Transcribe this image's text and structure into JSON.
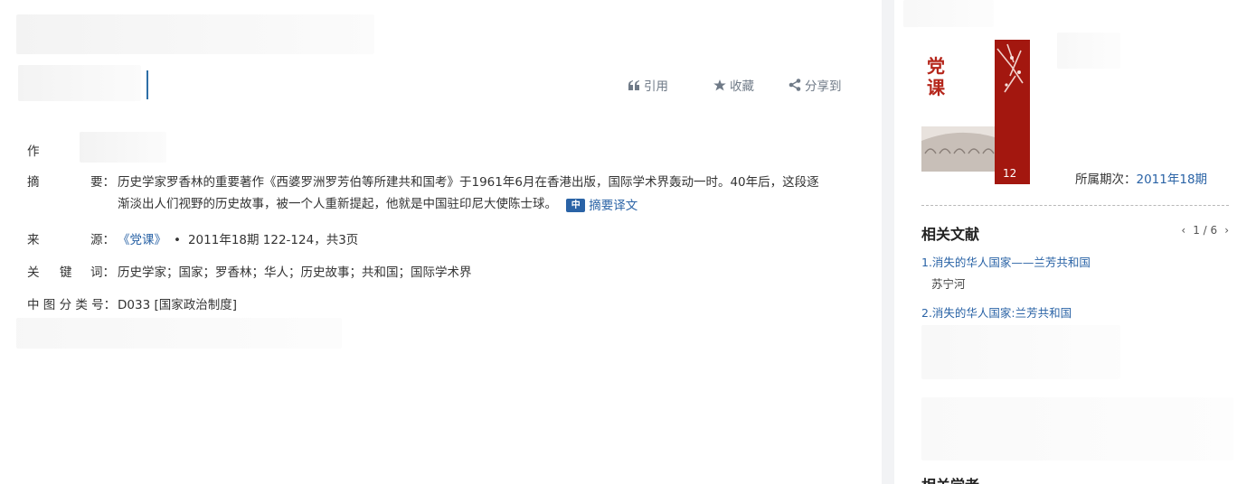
{
  "actions": {
    "cite": "引用",
    "favorite": "收藏",
    "share": "分享到"
  },
  "meta": {
    "author_label": "作",
    "abstract_label": [
      "摘",
      "要："
    ],
    "abstract_text": "历史学家罗香林的重要著作《西婆罗洲罗芳伯等所建共和国考》于1961年6月在香港出版，国际学术界轰动一时。40年后，这段逐渐淡出人们视野的历史故事，被一个人重新提起，他就是中国驻印尼大使陈士球。",
    "abstract_translate": "摘要译文",
    "translate_icon": "中",
    "source_label": [
      "来",
      "源："
    ],
    "source_journal": "《党课》",
    "source_detail": "2011年18期 122-124，共3页",
    "keywords_label": [
      "关",
      "键",
      "词："
    ],
    "keywords": "历史学家；国家；罗香林；华人；历史故事；共和国；国际学术界",
    "clc_label": "中 图 分 类 号：",
    "clc_value": "D033 [国家政治制度]"
  },
  "sidebar": {
    "cover": {
      "title_line1": "党",
      "title_line2": "课",
      "issue_no": "12"
    },
    "issue_label": "所属期次：",
    "issue_value": "2011年18期",
    "related_title": "相关文献",
    "pager": "1 / 6",
    "related": [
      {
        "title": "1.消失的华人国家——兰芳共和国",
        "author": "苏宁河"
      },
      {
        "title": "2.消失的华人国家:兰芳共和国",
        "author": ""
      }
    ],
    "scholars_title": "相关学者"
  },
  "colors": {
    "link": "#2a63a6",
    "cover_red": "#a3170f",
    "divider": "#f2f3f5"
  }
}
